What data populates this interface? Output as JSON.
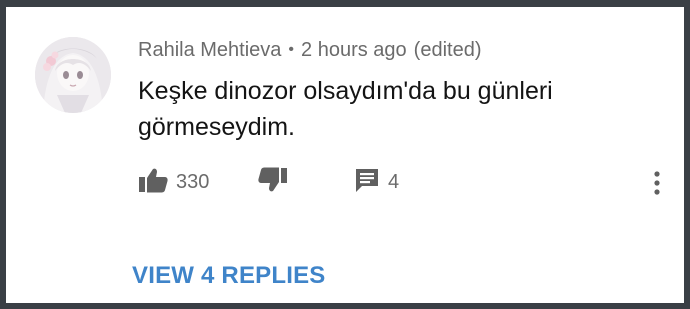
{
  "comment": {
    "author": "Rahila Mehtieva",
    "separator": "•",
    "time": "2 hours ago",
    "edited": "(edited)",
    "text": "Keşke dinozor olsaydım'da bu günleri görmeseydim."
  },
  "actions": {
    "like_icon": "thumbs-up-icon",
    "like_count": "330",
    "dislike_icon": "thumbs-down-icon",
    "reply_icon": "comment-icon",
    "reply_count": "4",
    "more_icon": "more-vertical-icon"
  },
  "replies": {
    "label": "VIEW 4 REPLIES",
    "color": "#3f84c9"
  },
  "colors": {
    "background": "#3a3f45",
    "card": "#ffffff",
    "meta_text": "#6b6b6b",
    "body_text": "#141414",
    "icon": "#606060"
  }
}
